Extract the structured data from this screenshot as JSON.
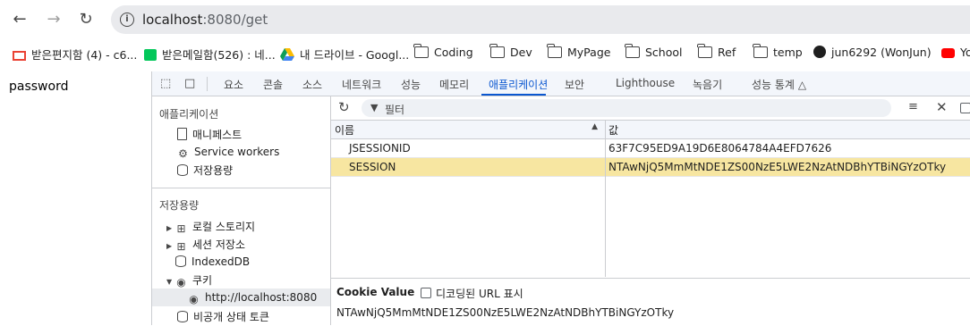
{
  "browser": {
    "url_host": "localhost",
    "url_rest": ":8080/get",
    "bookmarks": [
      {
        "label": "받은편지함 (4) - c6...",
        "icon": "gmail-icon"
      },
      {
        "label": "받은메일함(526) : 네...",
        "icon": "mail-icon"
      },
      {
        "label": "내 드라이브 - Googl...",
        "icon": "drive-icon"
      },
      {
        "label": "Coding",
        "icon": "folder-icon"
      },
      {
        "label": "Dev",
        "icon": "folder-icon"
      },
      {
        "label": "MyPage",
        "icon": "folder-icon"
      },
      {
        "label": "School",
        "icon": "folder-icon"
      },
      {
        "label": "Ref",
        "icon": "folder-icon"
      },
      {
        "label": "temp",
        "icon": "folder-icon"
      },
      {
        "label": "jun6292 (WonJun)",
        "icon": "github-icon"
      },
      {
        "label": "Yo",
        "icon": "youtube-icon"
      }
    ]
  },
  "page": {
    "text": "password"
  },
  "devtools": {
    "tabs": [
      "요소",
      "콘솔",
      "소스",
      "네트워크",
      "성능",
      "메모리",
      "애플리케이션",
      "보안",
      "Lighthouse",
      "녹음기",
      "성능 통계"
    ],
    "active_tab": "애플리케이션",
    "sidebar": {
      "app_header": "애플리케이션",
      "app_items": [
        "매니페스트",
        "Service workers",
        "저장용량"
      ],
      "storage_header": "저장용량",
      "storage_items": [
        "로컬 스토리지",
        "세션 저장소",
        "IndexedDB",
        "쿠키"
      ],
      "cookie_origin": "http://localhost:8080",
      "last_item": "비공개 상태 토큰"
    },
    "filter_placeholder": "필터",
    "table": {
      "headers": [
        "이름",
        "값"
      ],
      "rows": [
        {
          "name": "JSESSIONID",
          "value": "63F7C95ED9A19D6E8064784A4EFD7626"
        },
        {
          "name": "SESSION",
          "value": "NTAwNjQ5MmMtNDE1ZS00NzE5LWE2NzAtNDBhYTBiNGYzOTky"
        }
      ]
    },
    "cookie_value": {
      "label": "Cookie Value",
      "checkbox_label": "디코딩된 URL 표시",
      "value": "NTAwNjQ5MmMtNDE1ZS00NzE5LWE2NzAtNDBhYTBiNGYzOTky"
    }
  },
  "colors": {
    "accent": "#0b57d0",
    "selected_row": "#f7e6a1"
  }
}
